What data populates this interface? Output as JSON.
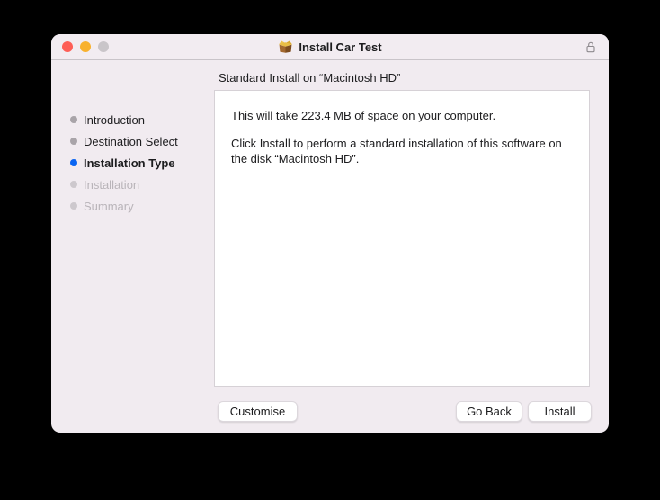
{
  "titlebar": {
    "title": "Install Car Test",
    "app_icon": "installer-package-icon",
    "traffic_lights": [
      "close",
      "minimize",
      "zoom-disabled"
    ],
    "lock_state": "locked"
  },
  "sidebar": {
    "items": [
      {
        "label": "Introduction",
        "state": "completed"
      },
      {
        "label": "Destination Select",
        "state": "completed"
      },
      {
        "label": "Installation Type",
        "state": "current"
      },
      {
        "label": "Installation",
        "state": "pending"
      },
      {
        "label": "Summary",
        "state": "pending"
      }
    ]
  },
  "content": {
    "heading": "Standard Install on “Macintosh HD”",
    "paragraphs": [
      "This will take 223.4 MB of space on your computer.",
      "Click Install to perform a standard installation of this software on the disk “Macintosh HD”."
    ]
  },
  "footer": {
    "customise": "Customise",
    "go_back": "Go Back",
    "install": "Install"
  },
  "colors": {
    "accent_blue": "#0a65f2",
    "window_bg": "#f1ebf0",
    "traffic_red": "#fe5e56",
    "traffic_yellow": "#f8b12e",
    "traffic_gray": "#c9c5c9",
    "desktop_bg": "#000000"
  }
}
